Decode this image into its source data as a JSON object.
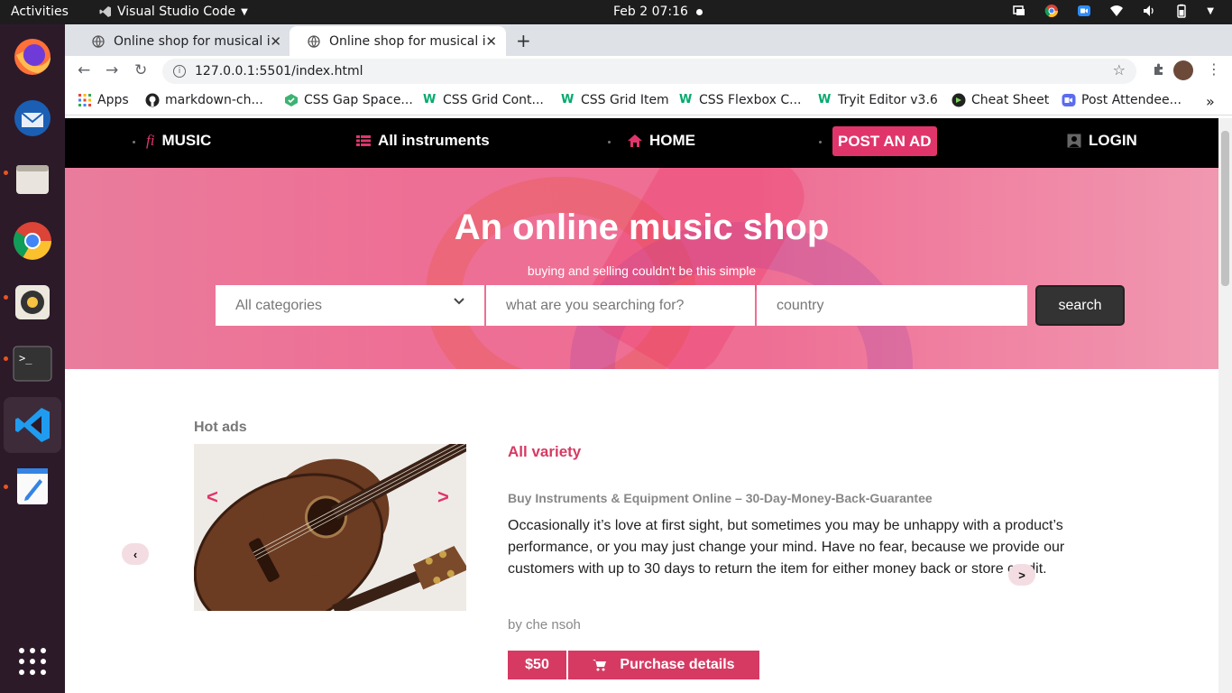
{
  "os": {
    "activities_label": "Activities",
    "app_name": "Visual Studio Code",
    "clock": "Feb 2  07:16",
    "dock_items": [
      "firefox-icon",
      "thunderbird-icon",
      "files-icon",
      "chrome-icon",
      "rhythmbox-icon",
      "terminal-icon",
      "vscode-icon",
      "text-editor-icon",
      "app-grid-icon"
    ]
  },
  "browser": {
    "tabs": [
      {
        "label": "Online shop for musical instruments",
        "active": false
      },
      {
        "label": "Online shop for musical instruments",
        "active": true
      }
    ],
    "url": "127.0.0.1:5501/index.html",
    "bookmarks": [
      {
        "label": "Apps",
        "icon": "apps-grid-icon"
      },
      {
        "label": "markdown-ch...",
        "icon": "github-icon"
      },
      {
        "label": "CSS Gap Space...",
        "icon": "css-gap-icon"
      },
      {
        "label": "CSS Grid Cont...",
        "icon": "w3schools-icon"
      },
      {
        "label": "CSS Grid Item",
        "icon": "w3schools-icon"
      },
      {
        "label": "CSS Flexbox C...",
        "icon": "w3schools-icon"
      },
      {
        "label": "Tryit Editor v3.6",
        "icon": "w3schools-icon"
      },
      {
        "label": "Cheat Sheet",
        "icon": "cheatsheet-icon"
      },
      {
        "label": "Post Attendee...",
        "icon": "zoom-icon"
      }
    ],
    "more_bookmarks": "»"
  },
  "site": {
    "nav": {
      "brand": "MUSIC",
      "instruments": "All instruments",
      "home": "HOME",
      "post_ad": "POST AN AD",
      "login": "LOGIN"
    },
    "hero": {
      "title": "An online music shop",
      "subtitle": "buying and selling couldn't be this simple",
      "category_placeholder": "All categories",
      "search_placeholder": "what are you searching for?",
      "country_placeholder": "country",
      "search_button": "search"
    },
    "hot_ads": {
      "label": "Hot ads",
      "variety_title": "All variety",
      "headline": "Buy Instruments & Equipment Online – 30-Day-Money-Back-Guarantee",
      "description": "Occasionally it’s love at first sight, but sometimes you may be unhappy with a product’s performance, or you may just change your mind. Have no fear, because we provide our customers with up to 30 days to return the item for either money back or store credit.",
      "author": "by che nsoh",
      "price": "$50",
      "purchase_label": "Purchase details",
      "prev_arrow": "‹",
      "next_arrow": ">",
      "image_prev": "<",
      "image_next": ">"
    }
  },
  "colors": {
    "accent": "#d63a63",
    "nav_bg": "#000000",
    "hero_pink": "#ee6f95"
  }
}
